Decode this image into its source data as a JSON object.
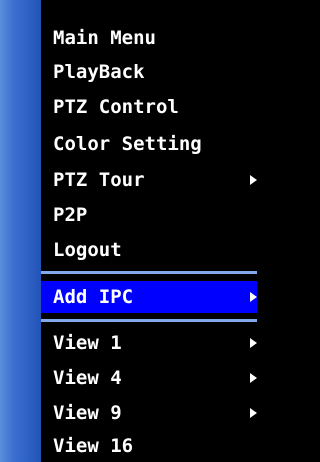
{
  "menu": {
    "items": [
      {
        "label": "Main Menu"
      },
      {
        "label": "PlayBack"
      },
      {
        "label": "PTZ Control"
      },
      {
        "label": "Color Setting"
      },
      {
        "label": "PTZ Tour"
      },
      {
        "label": "P2P"
      },
      {
        "label": "Logout"
      },
      {
        "label": "Add IPC"
      },
      {
        "label": "View 1"
      },
      {
        "label": "View 4"
      },
      {
        "label": "View 9"
      },
      {
        "label": "View 16"
      }
    ]
  },
  "colors": {
    "background": "#000000",
    "text": "#ffffff",
    "selected_highlight": "#0000ff",
    "divider": "#7fa9e8",
    "side_band": "#2f63c6"
  }
}
